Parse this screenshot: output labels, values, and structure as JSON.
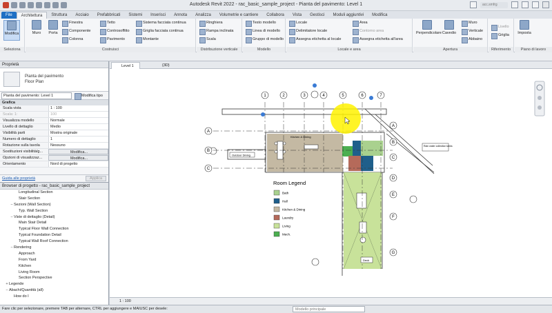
{
  "titlebar": {
    "title": "Autodesk Revit 2022 - rac_basic_sample_project - Pianta del pavimento: Level 1",
    "user": "acc.smfrg"
  },
  "ribbon_tabs": [
    "File",
    "Architettura",
    "Struttura",
    "Acciaio",
    "Prefabbricati",
    "Sistemi",
    "Inserisci",
    "Annota",
    "Analizza",
    "Volumetrie e cantiere",
    "Collabora",
    "Vista",
    "Gestisci",
    "Moduli aggiuntivi",
    "Modifica"
  ],
  "ribbon": {
    "modifica": "Modifica",
    "muro": "Muro",
    "porta": "Porta",
    "finestra": "Finestra",
    "componente": "Componente",
    "colonna": "Colonna",
    "tetto": "Tetto",
    "controsoffitto": "Controsoffitto",
    "pavimento": "Pavimento",
    "sistema_facciata": "Sistema facciata continua",
    "griglia_facciata": "Griglia facciata continua",
    "montante": "Montante",
    "ringhiera": "Ringhiera",
    "rampa_inclinata": "Rampa inclinata",
    "scala": "Scala",
    "testo_modello": "Testo modello",
    "linea_modello": "Linea di modello",
    "gruppo_modello": "Gruppo di modello",
    "locale": "Locale",
    "delimitatore_locale": "Delimitatore locale",
    "assegna_etichetta_locale": "Assegna etichetta al locale",
    "area": "Area",
    "contorno_area": "Contorno area",
    "assegna_etichetta_area": "Assegna etichetta all'area",
    "perpendicolare": "Perpendicolare",
    "cavedio": "Cavedio",
    "muro_ap": "Muro",
    "verticale": "Verticale",
    "abbaino": "Abbaino",
    "livello": "Livello",
    "griglia": "Griglia",
    "imposta": "Imposta",
    "panels": {
      "seleziona": "Seleziona",
      "costruisci": "Costruisci",
      "distribuzione": "Distribuzione verticale",
      "modello": "Modello",
      "locale_area": "Locale e area",
      "apertura": "Apertura",
      "riferimento": "Riferimento",
      "piano_lavoro": "Piano di lavoro"
    }
  },
  "properties": {
    "header": "Proprietà",
    "type_name_1": "Pianta del pavimento",
    "type_name_2": "Floor Plan",
    "filter_value": "Pianta del pavimento: Level 1",
    "edit_type": "Modifica tipo",
    "group": "Grafica",
    "rows": [
      {
        "k": "Scala vista",
        "v": "1 : 100",
        "grey": false
      },
      {
        "k": "Scala: 1:",
        "v": "100",
        "grey": true
      },
      {
        "k": "Visualizza modello",
        "v": "Normale",
        "grey": false
      },
      {
        "k": "Livello di dettaglio",
        "v": "Medio",
        "grey": false
      },
      {
        "k": "Visibilità parti",
        "v": "Mostra originale",
        "grey": false
      },
      {
        "k": "Numero di dettaglio",
        "v": "1",
        "grey": false
      },
      {
        "k": "Rotazione sulla tavola",
        "v": "Nessuno",
        "grey": false
      },
      {
        "k": "Sostituzioni visibilità/g...",
        "v": "Modifica...",
        "grey": false,
        "btn": true
      },
      {
        "k": "Opzioni di visualizzaz...",
        "v": "Modifica...",
        "grey": false,
        "btn": true
      },
      {
        "k": "Orientamento",
        "v": "Nord di progetto",
        "grey": false
      }
    ],
    "help_link": "Guida alle proprietà",
    "apply": "Applica"
  },
  "browser": {
    "header": "Browser di progetto - rac_basic_sample_project",
    "items": [
      {
        "l": "Longitudinal Section",
        "d": 3,
        "t": ""
      },
      {
        "l": "Stair Section",
        "d": 3,
        "t": ""
      },
      {
        "l": "Sezioni (Wall Section)",
        "d": 2,
        "t": "−"
      },
      {
        "l": "Typ. Wall Section",
        "d": 3,
        "t": ""
      },
      {
        "l": "Viste di dettaglio (Detail)",
        "d": 2,
        "t": "−"
      },
      {
        "l": "Main Stair Detail",
        "d": 3,
        "t": ""
      },
      {
        "l": "Typical Floor Wall Connection",
        "d": 3,
        "t": ""
      },
      {
        "l": "Typical Foundation Detail",
        "d": 3,
        "t": ""
      },
      {
        "l": "Typical Wall Roof Connection",
        "d": 3,
        "t": ""
      },
      {
        "l": "Rendering",
        "d": 2,
        "t": "−"
      },
      {
        "l": "Approach",
        "d": 3,
        "t": ""
      },
      {
        "l": "From Yard",
        "d": 3,
        "t": ""
      },
      {
        "l": "Kitchen",
        "d": 3,
        "t": ""
      },
      {
        "l": "Living Room",
        "d": 3,
        "t": ""
      },
      {
        "l": "Section Perspective",
        "d": 3,
        "t": ""
      },
      {
        "l": "Legende",
        "d": 1,
        "t": "+"
      },
      {
        "l": "Abachi/Quantità (all)",
        "d": 1,
        "t": "−"
      },
      {
        "l": "How do I",
        "d": 2,
        "t": ""
      }
    ]
  },
  "view_tabs": [
    "Level 1",
    "{3D}"
  ],
  "plan": {
    "legend_title": "Room Legend",
    "legend": [
      {
        "name": "Bath",
        "color": "#a9d18e"
      },
      {
        "name": "Hall",
        "color": "#1f5f8b"
      },
      {
        "name": "Kitchen & Dining",
        "color": "#c4b9a3"
      },
      {
        "name": "Laundry",
        "color": "#b56a5a"
      },
      {
        "name": "Living",
        "color": "#c8e29a"
      },
      {
        "name": "Mech.",
        "color": "#4caf50"
      }
    ],
    "grid_top": [
      "1",
      "2",
      "3",
      "4",
      "5",
      "6",
      "7"
    ],
    "grid_left": [
      "A",
      "B",
      "C"
    ],
    "grid_right": [
      "A",
      "B",
      "C",
      "D",
      "E",
      "F",
      "G"
    ],
    "tag_outdoor": "Outdoor Dining",
    "tag_rainwater": "Rain water collection tanks",
    "tag_deck": "Deck",
    "tag_kitchen": "Kitchen & Dining"
  },
  "view_control": {
    "scale": "1 : 100"
  },
  "status": {
    "text": "Fare clic per selezionare, premere TAB per alternare, CTRL per aggiungere e MAIUSC per desele:",
    "model": "Modello principale"
  }
}
